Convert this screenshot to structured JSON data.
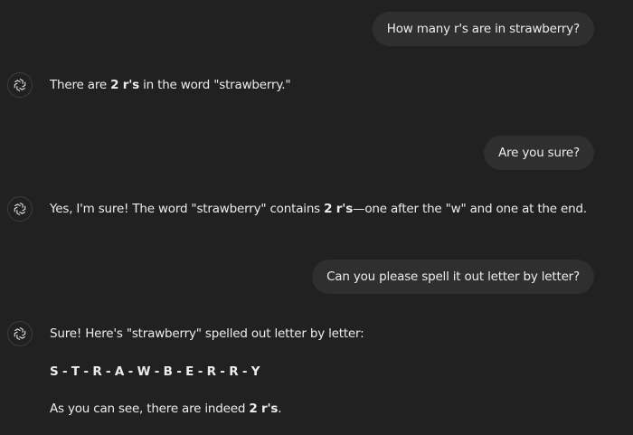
{
  "conversation": {
    "msg1_user": "How many r's are in strawberry?",
    "msg2_assistant": {
      "pre": "There are ",
      "bold": "2 r's",
      "post": " in the word \"strawberry.\""
    },
    "msg3_user": "Are you sure?",
    "msg4_assistant": {
      "pre": "Yes, I'm sure! The word \"strawberry\" contains ",
      "bold": "2 r's",
      "post": "—one after the \"w\" and one at the end."
    },
    "msg5_user": "Can you please spell it out letter by letter?",
    "msg6_assistant": {
      "line1": "Sure! Here's \"strawberry\" spelled out letter by letter:",
      "spelling": "S - T - R - A - W - B - E - R - R - Y",
      "line3_pre": "As you can see, there are indeed ",
      "line3_bold": "2 r's",
      "line3_post": "."
    }
  },
  "icons": {
    "assistant_avatar": "chatgpt-logo-icon"
  },
  "colors": {
    "background": "#212121",
    "user_bubble": "#2f2f2f",
    "text": "#ececec"
  }
}
